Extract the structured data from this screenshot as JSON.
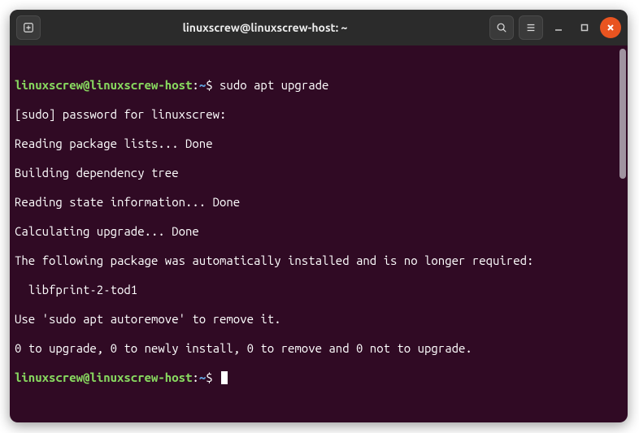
{
  "titlebar": {
    "title": "linuxscrew@linuxscrew-host: ~"
  },
  "prompt": {
    "user_host": "linuxscrew@linuxscrew-host",
    "sep": ":",
    "path": "~",
    "symbol": "$"
  },
  "session": {
    "command1": "sudo apt upgrade",
    "lines": [
      "[sudo] password for linuxscrew:",
      "Reading package lists... Done",
      "Building dependency tree",
      "Reading state information... Done",
      "Calculating upgrade... Done",
      "The following package was automatically installed and is no longer required:",
      "  libfprint-2-tod1",
      "Use 'sudo apt autoremove' to remove it.",
      "0 to upgrade, 0 to newly install, 0 to remove and 0 not to upgrade."
    ]
  }
}
